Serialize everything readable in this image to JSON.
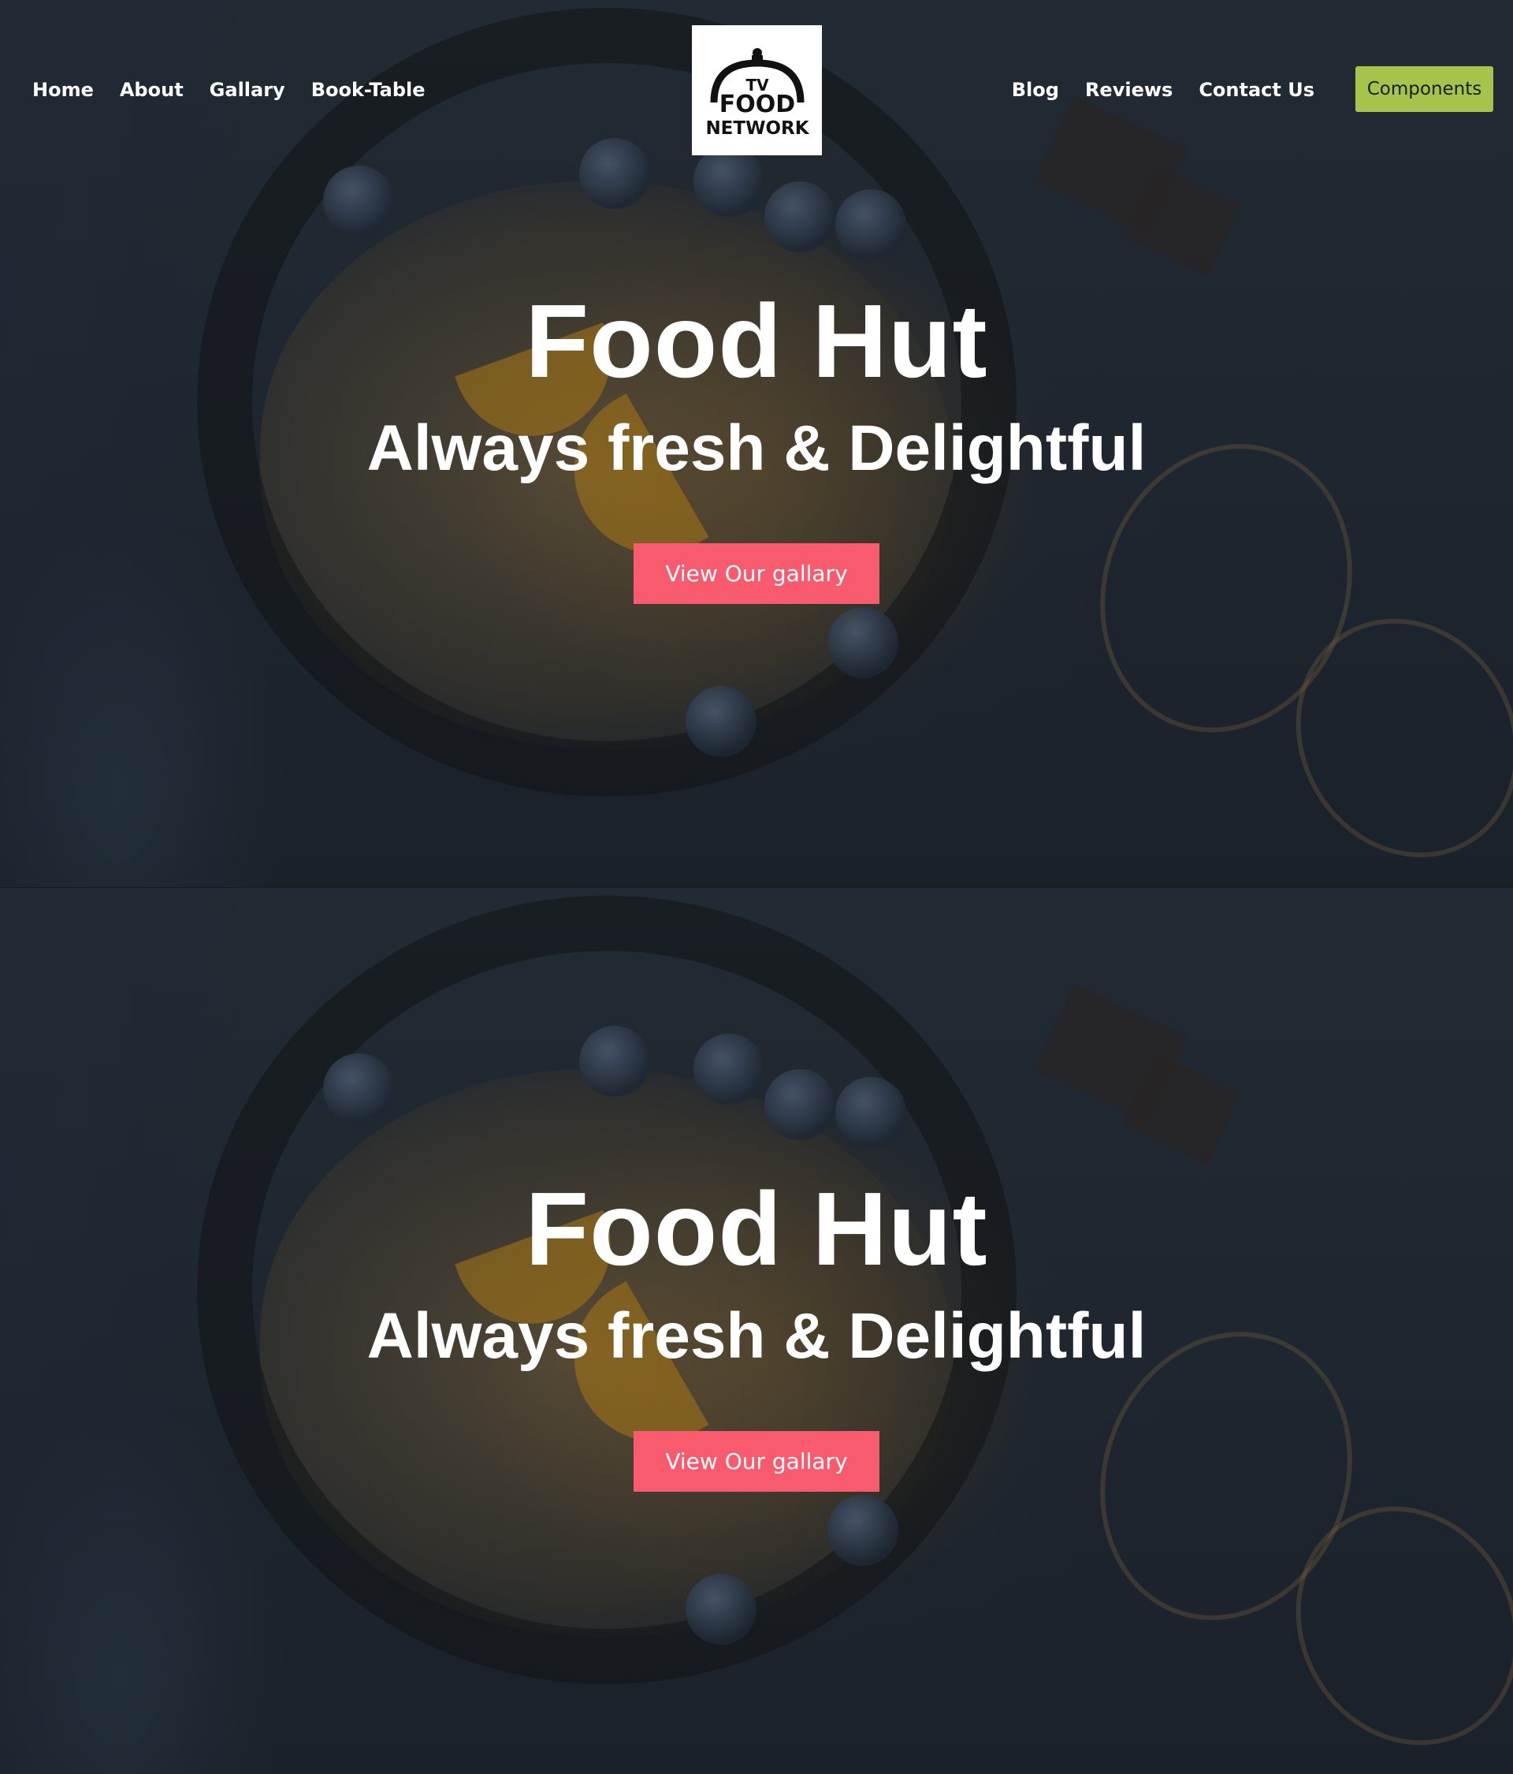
{
  "nav": {
    "left_links": [
      "Home",
      "About",
      "Gallary",
      "Book-Table"
    ],
    "right_links": [
      "Blog",
      "Reviews",
      "Contact Us"
    ],
    "components_label": "Components",
    "logo": {
      "line1": "TV",
      "line2": "FOOD",
      "line3": "NETWORK"
    }
  },
  "hero": {
    "title": "Food Hut",
    "subtitle": "Always fresh & Delightful",
    "cta_label": "View Our gallary"
  },
  "hero2": {
    "title": "Food Hut",
    "subtitle": "Always fresh & Delightful",
    "cta_label": "View Our gallary"
  },
  "colors": {
    "cta": "#f85a6e",
    "components": "#a5c44b",
    "background": "#1e2630"
  }
}
